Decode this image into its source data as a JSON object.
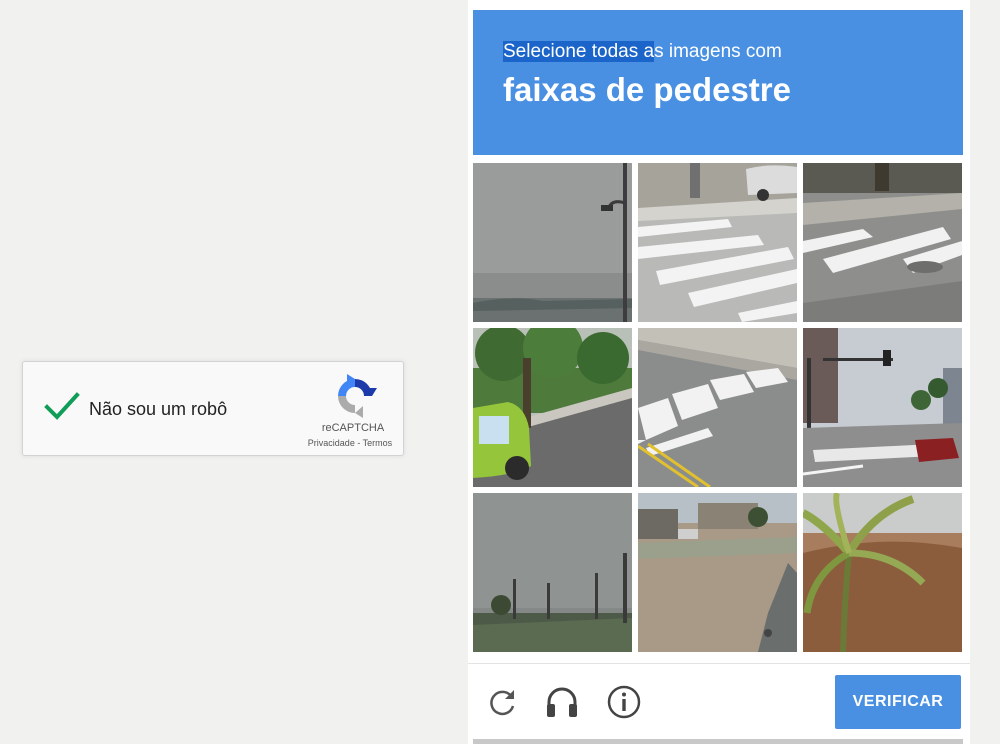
{
  "checkbox_widget": {
    "label": "Não sou um robô",
    "brand": "reCAPTCHA",
    "privacy": "Privacidade",
    "separator": " - ",
    "terms": "Termos"
  },
  "challenge": {
    "instruction_highlighted": "Selecione todas a",
    "instruction_rest": "s imagens com",
    "target": "faixas de pedestre",
    "tiles": [
      {
        "index": 1,
        "scene": "overcast sky with street lamp and distant water"
      },
      {
        "index": 2,
        "scene": "crosswalk stripes near curb and parked car"
      },
      {
        "index": 3,
        "scene": "crosswalk stripes on road with sidewalk"
      },
      {
        "index": 4,
        "scene": "trees, lawn and green car on street"
      },
      {
        "index": 5,
        "scene": "crosswalk stripes with yellow road lines"
      },
      {
        "index": 6,
        "scene": "city intersection with traffic light and crosswalk"
      },
      {
        "index": 7,
        "scene": "overcast sky with street lights and trees"
      },
      {
        "index": 8,
        "scene": "gravel roadside with houses and car"
      },
      {
        "index": 9,
        "scene": "palm plant and dry bushes"
      }
    ],
    "verify_label": "VERIFICAR"
  },
  "icons": {
    "reload": "reload-icon",
    "audio": "headphones-icon",
    "info": "info-icon",
    "check": "checkmark-icon",
    "logo": "recaptcha-logo-icon"
  },
  "colors": {
    "accent": "#4a90e2",
    "check_green": "#0f9d58",
    "page_background": "#f1f1f0"
  }
}
